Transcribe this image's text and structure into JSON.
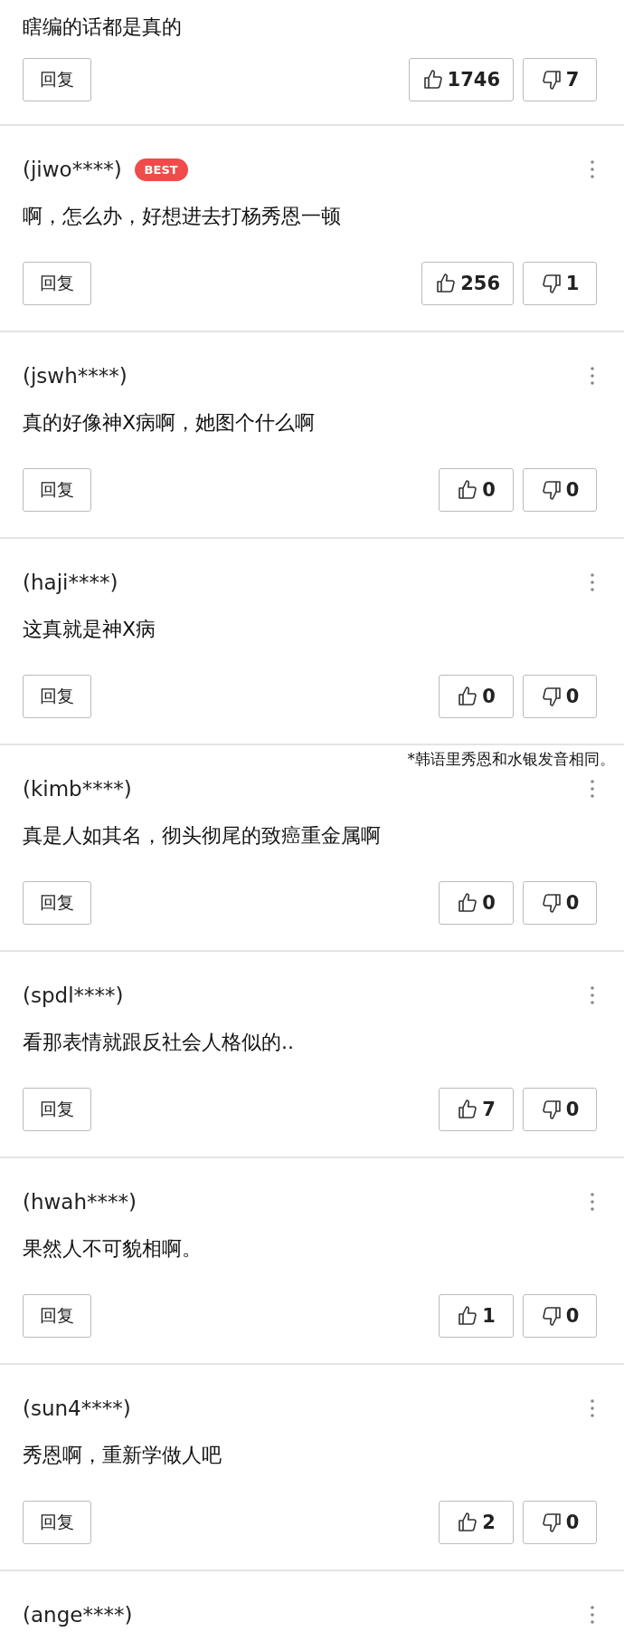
{
  "top_comment": {
    "text": "瞎编的话都是真的",
    "reply_label": "回复",
    "likes": "1746",
    "dislikes": "7"
  },
  "comments": [
    {
      "author": "(jiwo****)",
      "badge": "BEST",
      "text": "啊，怎么办，好想进去打杨秀恩一顿",
      "reply_label": "回复",
      "likes": "256",
      "dislikes": "1"
    },
    {
      "author": "(jswh****)",
      "text": "真的好像神X病啊，她图个什么啊",
      "reply_label": "回复",
      "likes": "0",
      "dislikes": "0"
    },
    {
      "author": "(haji****)",
      "text": "这真就是神X病",
      "reply_label": "回复",
      "likes": "0",
      "dislikes": "0"
    },
    {
      "author": "(kimb****)",
      "note": "*韩语里秀恩和水银发音相同。",
      "text": "真是人如其名，彻头彻尾的致癌重金属啊",
      "reply_label": "回复",
      "likes": "0",
      "dislikes": "0"
    },
    {
      "author": "(spdl****)",
      "text": "看那表情就跟反社会人格似的..",
      "reply_label": "回复",
      "likes": "7",
      "dislikes": "0"
    },
    {
      "author": "(hwah****)",
      "text": "果然人不可貌相啊。",
      "reply_label": "回复",
      "likes": "1",
      "dislikes": "0"
    },
    {
      "author": "(sun4****)",
      "text": "秀恩啊，重新学做人吧",
      "reply_label": "回复",
      "likes": "2",
      "dislikes": "0"
    }
  ],
  "last_comment": {
    "author": "(ange****)"
  }
}
